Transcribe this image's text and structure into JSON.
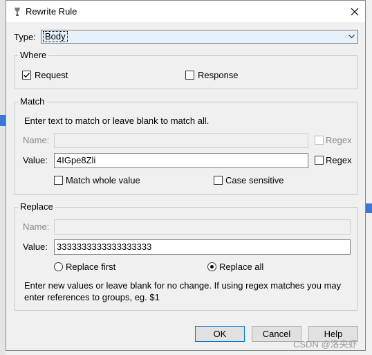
{
  "dialog": {
    "title": "Rewrite Rule",
    "type_label": "Type:",
    "type_value": "Body"
  },
  "where": {
    "title": "Where",
    "request_label": "Request",
    "request_checked": true,
    "response_label": "Response",
    "response_checked": false
  },
  "match": {
    "title": "Match",
    "hint": "Enter text to match or leave blank to match all.",
    "name_label": "Name:",
    "name_value": "",
    "name_regex_label": "Regex",
    "value_label": "Value:",
    "value_value": "4IGpe8Zli",
    "value_regex_label": "Regex",
    "match_whole_label": "Match whole value",
    "case_sensitive_label": "Case sensitive"
  },
  "replace": {
    "title": "Replace",
    "name_label": "Name:",
    "name_value": "",
    "value_label": "Value:",
    "value_value": "3333333333333333333",
    "replace_first_label": "Replace first",
    "replace_all_label": "Replace all",
    "selected": "Replace all",
    "hint_line1": "Enter new values or leave blank for no change. If using regex matches you may",
    "hint_line2": "enter references to groups, eg. $1"
  },
  "buttons": {
    "ok": "OK",
    "cancel": "Cancel",
    "help": "Help"
  },
  "watermark": "CSDN @洛央虾"
}
